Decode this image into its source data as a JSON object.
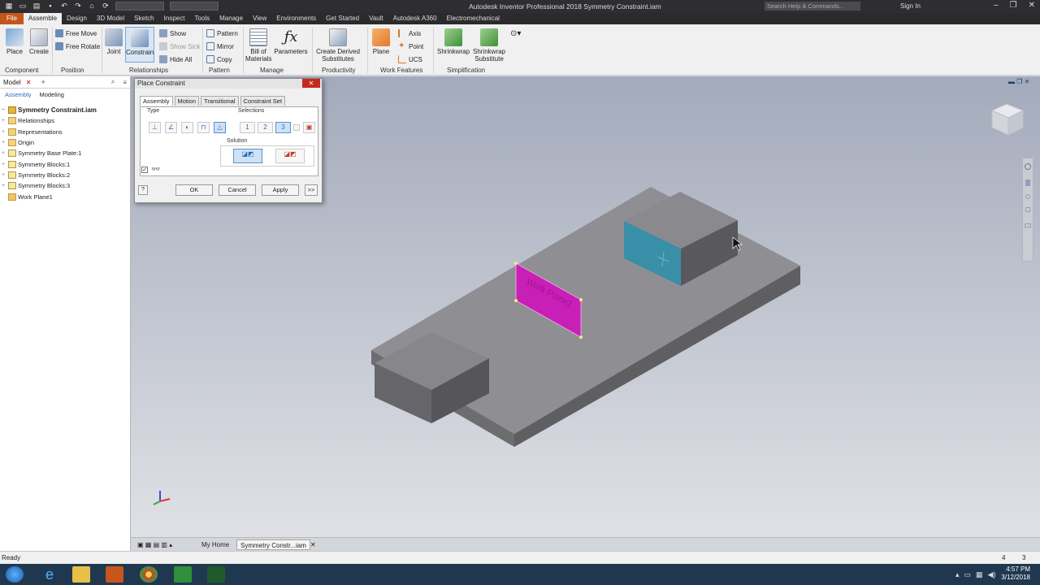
{
  "window": {
    "title": "Autodesk Inventor Professional 2018   Symmetry Constraint.iam",
    "search_placeholder": "Search Help & Commands...",
    "signin": "Sign In"
  },
  "menu_tabs": [
    "File",
    "Assemble",
    "Design",
    "3D Model",
    "Sketch",
    "Inspect",
    "Tools",
    "Manage",
    "View",
    "Environments",
    "Get Started",
    "Vault",
    "Autodesk A360",
    "Electromechanical"
  ],
  "active_tab": "Assemble",
  "ribbon": {
    "place": "Place",
    "create": "Create",
    "free_move": "Free Move",
    "free_rotate": "Free Rotate",
    "joint": "Joint",
    "constrain": "Constrain",
    "show": "Show",
    "show_sick": "Show Sick",
    "hide_all": "Hide All",
    "pattern": "Pattern",
    "mirror": "Mirror",
    "copy": "Copy",
    "bom_line1": "Bill of",
    "bom_line2": "Materials",
    "parameters": "Parameters",
    "derived_line1": "Create Derived",
    "derived_line2": "Substitutes",
    "plane": "Plane",
    "axis": "Axis",
    "point": "Point",
    "ucs": "UCS",
    "shrinkwrap": "Shrinkwrap",
    "shrinkwrap_sub_line1": "Shrinkwrap",
    "shrinkwrap_sub_line2": "Substitute",
    "panels": {
      "component": "Component",
      "position": "Position",
      "relationships": "Relationships",
      "pattern": "Pattern",
      "manage": "Manage",
      "productivity": "Productivity",
      "work_features": "Work Features",
      "simplification": "Simplification"
    }
  },
  "browser": {
    "header": "Model",
    "subtabs": [
      "Assembly",
      "Modeling"
    ],
    "root": "Symmetry Constraint.iam",
    "items": [
      "Relationships",
      "Representations",
      "Origin",
      "Symmetry Base Plate:1",
      "Symmetry Blocks:1",
      "Symmetry Blocks:2",
      "Symmetry Blocks:3",
      "Work Plane1"
    ]
  },
  "dialog": {
    "title": "Place Constraint",
    "tabs": [
      "Assembly",
      "Motion",
      "Transitional",
      "Constraint Set"
    ],
    "type_label": "Type",
    "selections_label": "Selections",
    "solution_label": "Solution",
    "ok": "OK",
    "cancel": "Cancel",
    "apply": "Apply",
    "more": ">>",
    "sel1": "1",
    "sel2": "2",
    "sel3": "3"
  },
  "viewport": {
    "work_plane_label": "Work Plane1"
  },
  "doc_tabs": {
    "home": "My Home",
    "doc": "Symmetry Constr...iam"
  },
  "status": {
    "text": "Ready",
    "num1": "4",
    "num2": "3"
  },
  "taskbar": {
    "time": "4:57 PM",
    "date": "3/12/2018"
  },
  "colors": {
    "work_plane": "#c81fb6",
    "selected_face": "#3a8fa8",
    "file_tab": "#c5561c",
    "accent": "#2a6ebd"
  }
}
